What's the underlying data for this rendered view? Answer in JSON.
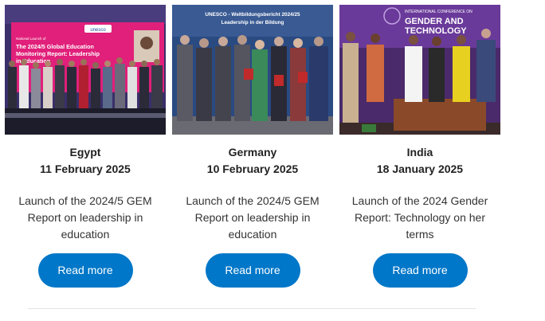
{
  "events": [
    {
      "country": "Egypt",
      "date": "11 February 2025",
      "description": "Launch of the 2024/5 GEM Report on leadership in education",
      "button_label": "Read more",
      "photo_banner_lines": [
        "National Launch of",
        "The 2024/5 Global Education",
        "Monitoring Report: Leadership",
        "in Education"
      ],
      "photo_logo_text": "unesco"
    },
    {
      "country": "Germany",
      "date": "10 February 2025",
      "description": "Launch of the 2024/5 GEM Report on leadership in education",
      "button_label": "Read more",
      "photo_banner_lines": [
        "UNESCO - Weltbildungsbericht 2024/25",
        "Leadership in der Bildung"
      ]
    },
    {
      "country": "India",
      "date": "18 January 2025",
      "description": "Launch of the 2024 Gender Report: Technology on her terms",
      "button_label": "Read more",
      "photo_banner_lines": [
        "INTERNATIONAL CONFERENCE ON",
        "GENDER AND",
        "TECHNOLOGY"
      ]
    }
  ],
  "colors": {
    "button": "#0077c8",
    "egypt_banner": "#e0207a",
    "germany_wall": "#2a4a82",
    "india_banner": "#6a3a9a"
  }
}
